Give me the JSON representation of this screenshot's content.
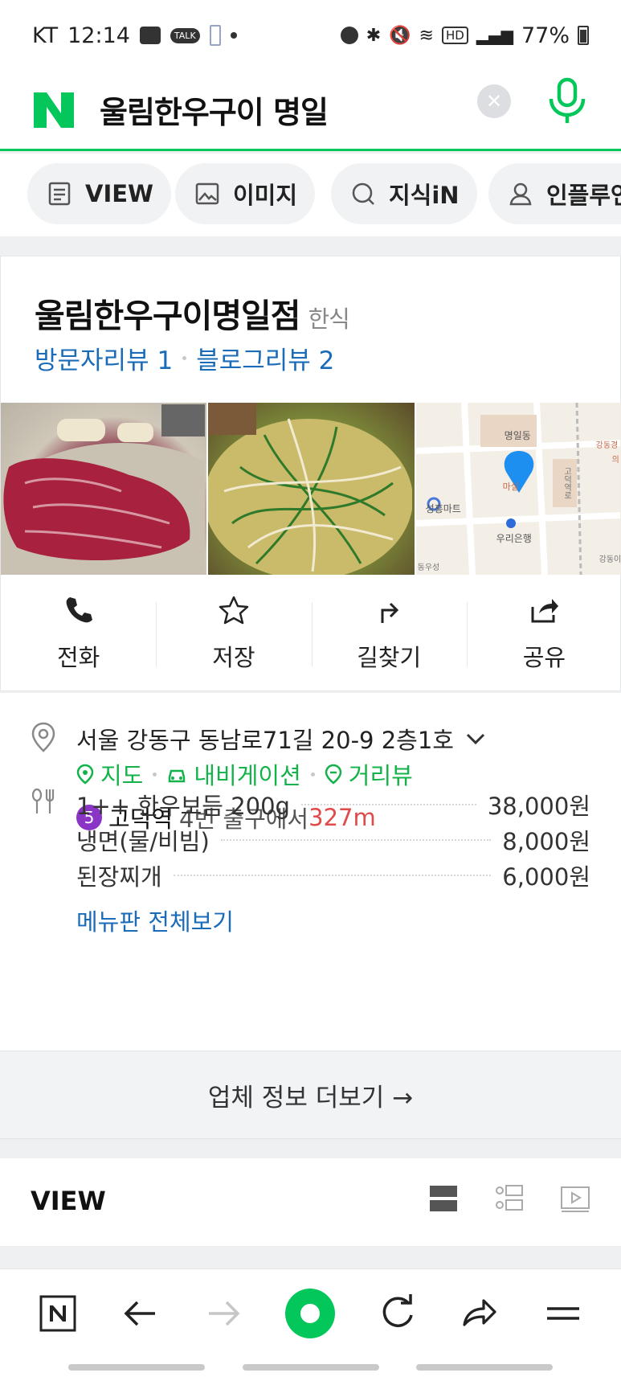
{
  "status_bar": {
    "carrier": "KT",
    "time": "12:14",
    "talk": "TALK",
    "battery": "77%"
  },
  "search": {
    "query": "울림한우구이 명일"
  },
  "tabs": [
    {
      "label": "VIEW",
      "icon": "document-icon"
    },
    {
      "label": "이미지",
      "icon": "image-icon"
    },
    {
      "label": "지식iN",
      "icon": "search-q-icon"
    },
    {
      "label": "인플루언",
      "icon": "person-icon"
    }
  ],
  "place": {
    "name": "울림한우구이명일점",
    "category": "한식",
    "visitor_review": "방문자리뷰 1",
    "blog_review": "블로그리뷰 2",
    "map_labels": {
      "a": "명일동",
      "b": "성흥마트",
      "c": "우리은행",
      "d": "마실",
      "e": "강동경",
      "f": "강동이",
      "g": "동우성",
      "h": "고덕역로",
      "i": "의"
    },
    "actions": [
      {
        "label": "전화",
        "icon": "phone-icon"
      },
      {
        "label": "저장",
        "icon": "star-icon"
      },
      {
        "label": "길찾기",
        "icon": "directions-icon"
      },
      {
        "label": "공유",
        "icon": "share-icon"
      }
    ]
  },
  "info": {
    "address": "서울 강동구 동남로71길 20-9 2층1호",
    "links": [
      "지도",
      "내비게이션",
      "거리뷰"
    ],
    "subway": {
      "line": "5",
      "line_color": "#8b35c7",
      "station": "고덕역",
      "exit": "4번 출구에서",
      "distance": "327m"
    },
    "menu": [
      {
        "name": "1++ 한우보듬 200g",
        "price": "38,000원"
      },
      {
        "name": "냉면(물/비빔)",
        "price": "8,000원"
      },
      {
        "name": "된장찌개",
        "price": "6,000원"
      }
    ],
    "menu_all": "메뉴판 전체보기"
  },
  "more_label": "업체 정보 더보기 →",
  "view_section": {
    "title": "VIEW"
  },
  "colors": {
    "naver_green": "#03c75a",
    "link_blue": "#1a6bb8",
    "link_green": "#14b24a",
    "distance_red": "#e14a4a"
  }
}
